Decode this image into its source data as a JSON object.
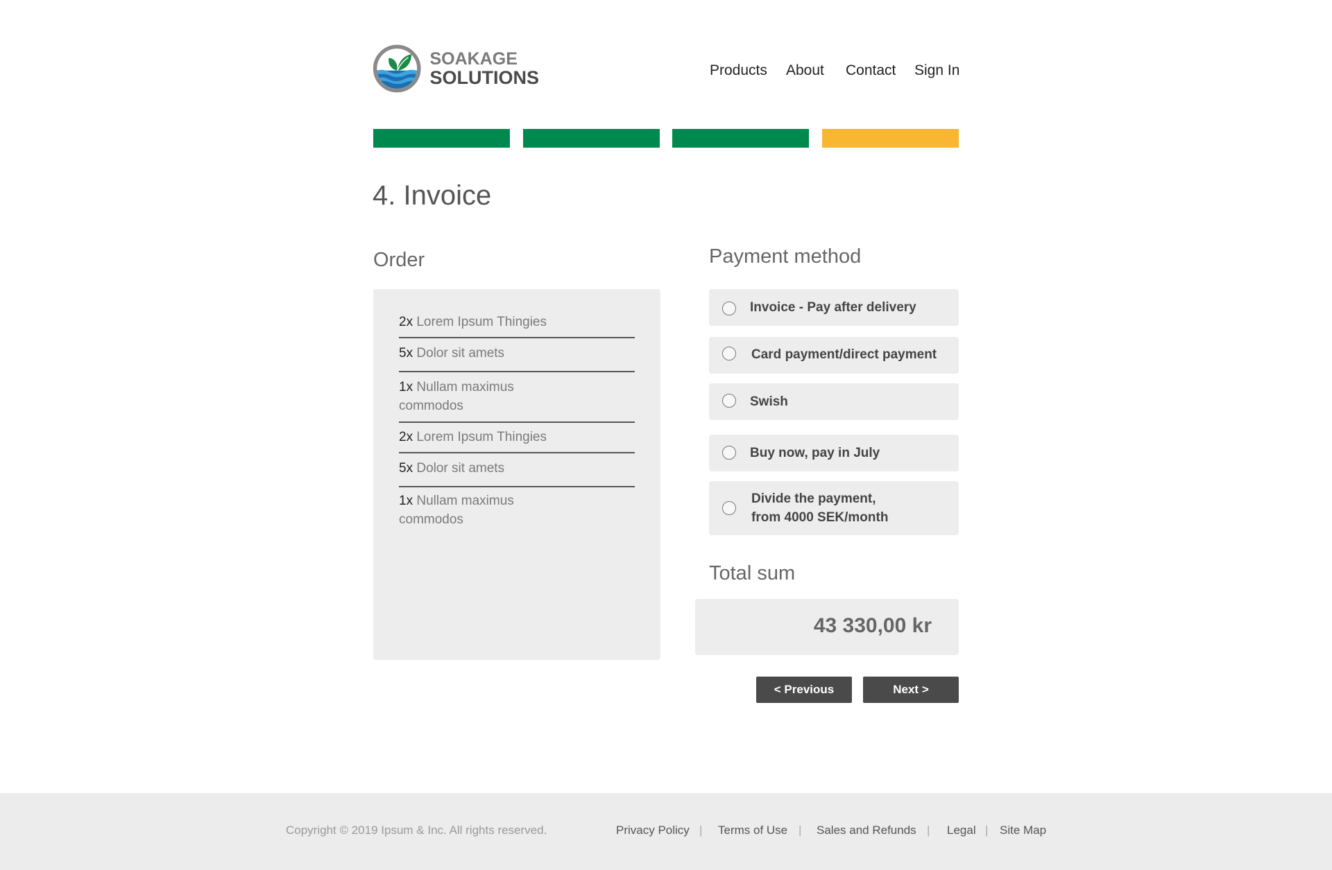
{
  "brand": {
    "line1": "SOAKAGE",
    "line2": "SOLUTIONS"
  },
  "nav": {
    "items": [
      "Products",
      "About",
      "Contact",
      "Sign In"
    ]
  },
  "progress": {
    "total_steps": 4,
    "current_step": 4,
    "completed_color": "#00894f",
    "current_color": "#f8b633"
  },
  "page": {
    "title": "4. Invoice"
  },
  "order": {
    "title": "Order",
    "items": [
      {
        "qty": "2x",
        "name": "Lorem Ipsum Thingies"
      },
      {
        "qty": "5x",
        "name": "Dolor sit amets"
      },
      {
        "qty": "1x",
        "name_line1": "Nullam maximus",
        "name_line2": "commodos"
      },
      {
        "qty": "2x",
        "name": "Lorem Ipsum Thingies"
      },
      {
        "qty": "5x",
        "name": "Dolor sit amets"
      },
      {
        "qty": "1x",
        "name_line1": "Nullam maximus",
        "name_line2": "commodos"
      }
    ]
  },
  "payment": {
    "title": "Payment method",
    "options": [
      {
        "label": "Invoice - Pay after delivery"
      },
      {
        "label": "Card payment/direct payment"
      },
      {
        "label": "Swish"
      },
      {
        "label": "Buy now, pay in July"
      },
      {
        "label_line1": "Divide the payment,",
        "label_line2": "from 4000 SEK/month"
      }
    ]
  },
  "total": {
    "title": "Total sum",
    "value": "43 330,00 kr"
  },
  "buttons": {
    "previous": "< Previous",
    "next": "Next >"
  },
  "footer": {
    "copyright": "Copyright © 2019 Ipsum & Inc. All rights reserved.",
    "links": [
      "Privacy Policy",
      "Terms of Use",
      "Sales and Refunds",
      "Legal",
      "Site Map"
    ],
    "separator": "|"
  },
  "icons": {
    "logo": "leaf-water-logo-icon",
    "radio": "radio-unchecked-icon"
  }
}
